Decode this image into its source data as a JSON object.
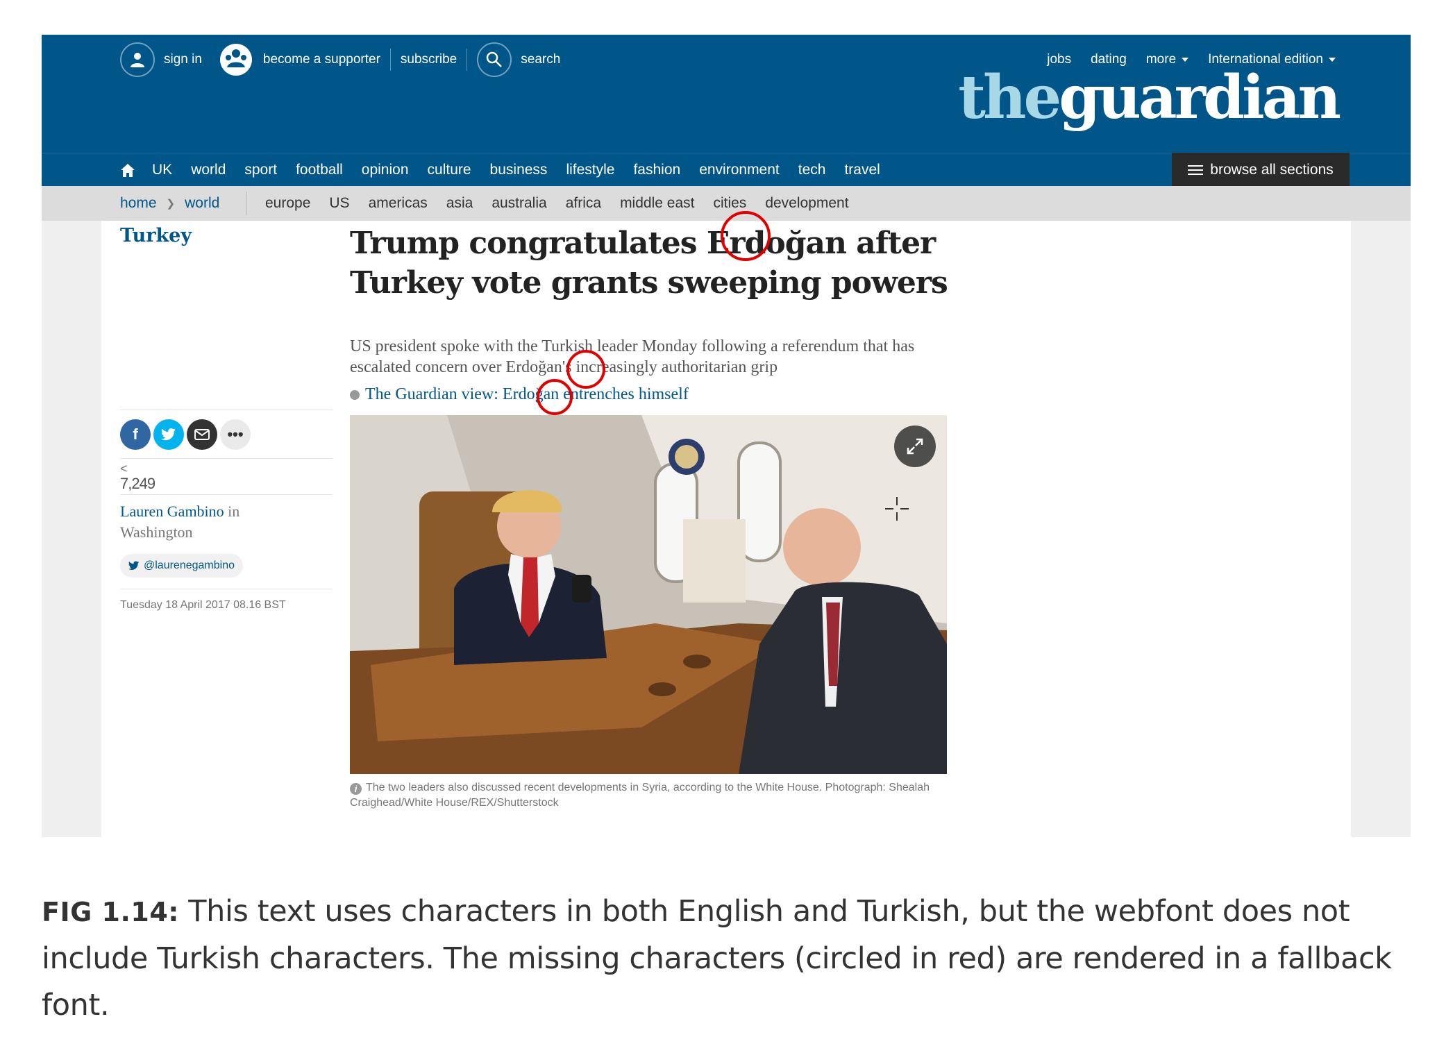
{
  "masthead": {
    "sign_in": "sign in",
    "supporter": "become a supporter",
    "subscribe": "subscribe",
    "search": "search",
    "jobs": "jobs",
    "dating": "dating",
    "more": "more",
    "edition": "International edition",
    "logo_the": "the",
    "logo_guardian": "guardian",
    "color_brand": "#005689"
  },
  "nav": {
    "items": [
      "UK",
      "world",
      "sport",
      "football",
      "opinion",
      "culture",
      "business",
      "lifestyle",
      "fashion",
      "environment",
      "tech",
      "travel"
    ],
    "browse": "browse all sections"
  },
  "subnav": {
    "breadcrumb": [
      "home",
      "world"
    ],
    "items": [
      "europe",
      "US",
      "americas",
      "asia",
      "australia",
      "africa",
      "middle east",
      "cities",
      "development"
    ]
  },
  "article": {
    "section": "Turkey",
    "headline": "Trump congratulates Erdoğan after Turkey vote grants sweeping powers",
    "standfirst": "US president spoke with the Turkish leader Monday following a referendum that has escalated concern over Erdoğan's increasingly authoritarian grip",
    "related_link": "The Guardian view: Erdoğan entrenches himself",
    "share_count": "7,249",
    "author": "Lauren Gambino",
    "location_prefix": "in",
    "location": "Washington",
    "twitter": "@laurenegambino",
    "date": "Tuesday 18 April 2017 08.16 BST",
    "photo_caption": "The two leaders also discussed recent developments in Syria, according to the White House. Photograph: Shealah Craighead/White House/REX/Shutterstock",
    "icons": [
      "facebook-icon",
      "twitter-icon",
      "email-icon",
      "more-icon",
      "expand-icon",
      "info-icon"
    ]
  },
  "figure": {
    "label": "FIG 1.14:",
    "caption": "This text uses characters in both English and Turkish, but the webfont does not include Turkish characters. The missing characters (circled in red) are rendered in a fallback font.",
    "highlight_color": "#e00000"
  }
}
